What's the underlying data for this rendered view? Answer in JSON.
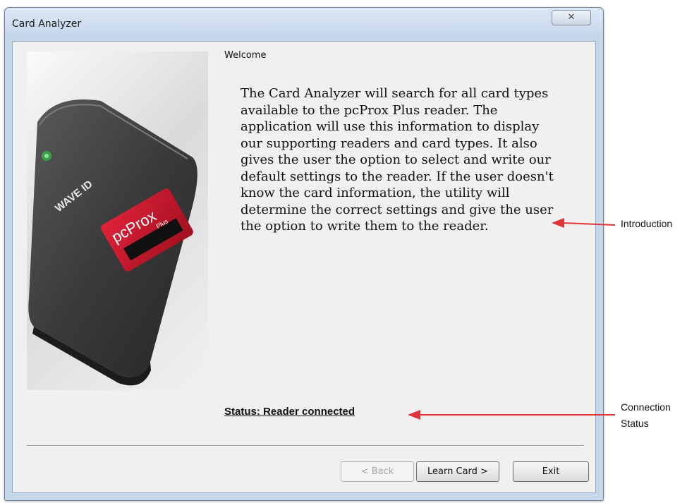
{
  "window": {
    "title": "Card Analyzer",
    "close_glyph": "✕"
  },
  "content": {
    "heading": "Welcome",
    "intro": "The Card Analyzer will search for all card types available to the pcProx Plus reader. The application will use this information to display our supporting readers and card types. It also gives the user the option to select and write our default  settings to the reader. If the user doesn't know the card information, the utility will determine the correct settings and give the user the option to write them to the reader.",
    "status": "Status: Reader connected"
  },
  "image": {
    "brand": "WAVE ID",
    "product": "pcProx",
    "product_sub": "Plus"
  },
  "buttons": {
    "back": "< Back",
    "learn": "Learn Card >",
    "exit": "Exit"
  },
  "annotations": {
    "introduction": "Introduction",
    "connection_status": "Connection Status"
  },
  "colors": {
    "arrow": "#e0333a",
    "accent_red": "#c8102e"
  }
}
